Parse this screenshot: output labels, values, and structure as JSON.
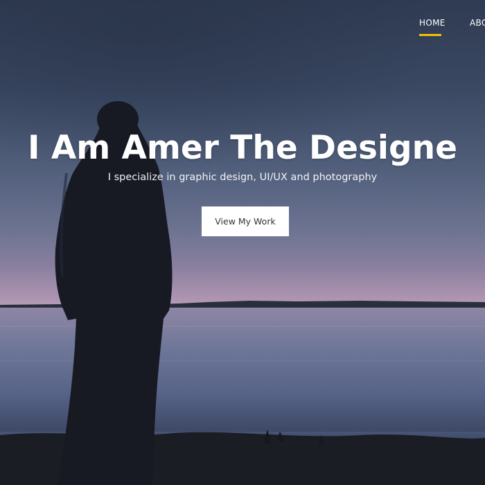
{
  "nav": {
    "items": [
      {
        "label": "HOME",
        "active": true
      },
      {
        "label": "ABO",
        "active": false
      }
    ],
    "active_color": "#f5c400"
  },
  "hero": {
    "title": "I Am Amer The Designe",
    "subtitle": "I specialize in graphic design, UI/UX and photography",
    "cta_label": "View My Work"
  }
}
